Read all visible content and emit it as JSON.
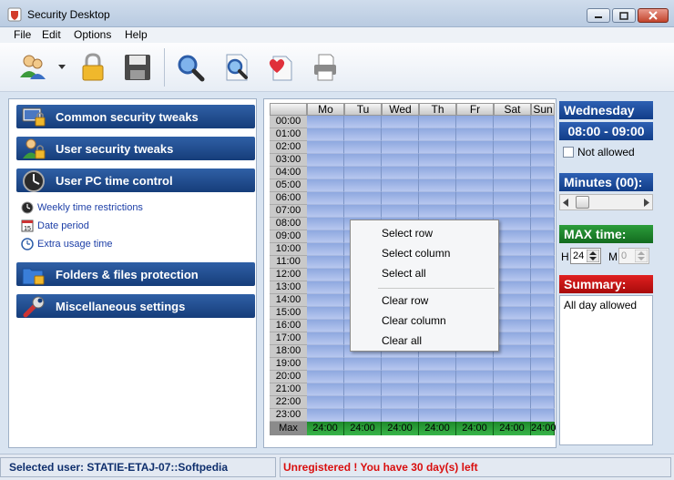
{
  "window": {
    "title": "Security Desktop",
    "icon": "app-shield-icon"
  },
  "menu": [
    "File",
    "Edit",
    "Options",
    "Help"
  ],
  "toolbar": {
    "buttons": [
      "users-icon",
      "lock-icon",
      "save-icon",
      "search-icon",
      "find-icon",
      "favorite-icon",
      "print-icon"
    ]
  },
  "sidebar": {
    "categories": [
      {
        "label": "Common security tweaks",
        "icon": "computer-lock-icon"
      },
      {
        "label": "User security tweaks",
        "icon": "user-lock-icon"
      },
      {
        "label": "User PC time control",
        "icon": "clock-icon"
      },
      {
        "label": "Folders & files protection",
        "icon": "folder-lock-icon"
      },
      {
        "label": "Miscellaneous settings",
        "icon": "wrench-icon"
      }
    ],
    "sub_items": [
      {
        "label": "Weekly time restrictions",
        "icon": "clock-small-icon"
      },
      {
        "label": "Date period",
        "icon": "calendar-icon"
      },
      {
        "label": "Extra usage time",
        "icon": "refresh-clock-icon"
      }
    ]
  },
  "schedule": {
    "days": [
      "Mo",
      "Tu",
      "Wed",
      "Th",
      "Fr",
      "Sat",
      "Sun"
    ],
    "hours": [
      "00:00",
      "01:00",
      "02:00",
      "03:00",
      "04:00",
      "05:00",
      "06:00",
      "07:00",
      "08:00",
      "09:00",
      "10:00",
      "11:00",
      "12:00",
      "13:00",
      "14:00",
      "15:00",
      "16:00",
      "17:00",
      "18:00",
      "19:00",
      "20:00",
      "21:00",
      "22:00",
      "23:00"
    ],
    "max_label": "Max",
    "max_values": [
      "24:00",
      "24:00",
      "24:00",
      "24:00",
      "24:00",
      "24:00",
      "24:00"
    ]
  },
  "context_menu": {
    "items": [
      "Select row",
      "Select column",
      "Select all",
      "Clear row",
      "Clear column",
      "Clear all"
    ]
  },
  "details": {
    "day": "Wednesday",
    "time_range": "08:00 - 09:00",
    "not_allowed_label": "Not allowed",
    "minutes_label": "Minutes (00):",
    "max_time_label": "MAX time:",
    "h_label": "H",
    "h_value": "24",
    "m_label": "M",
    "m_value": "0",
    "summary_label": "Summary:",
    "summary_text": "All day allowed"
  },
  "status": {
    "user": "Selected user: STATIE-ETAJ-07::Softpedia",
    "registration": "Unregistered ! You have 30 day(s) left"
  },
  "colors": {
    "category_blue": "#163d7a",
    "max_green": "#2c9d3b",
    "summary_red": "#c8100f",
    "slot_blue": "#9fb5e6"
  }
}
